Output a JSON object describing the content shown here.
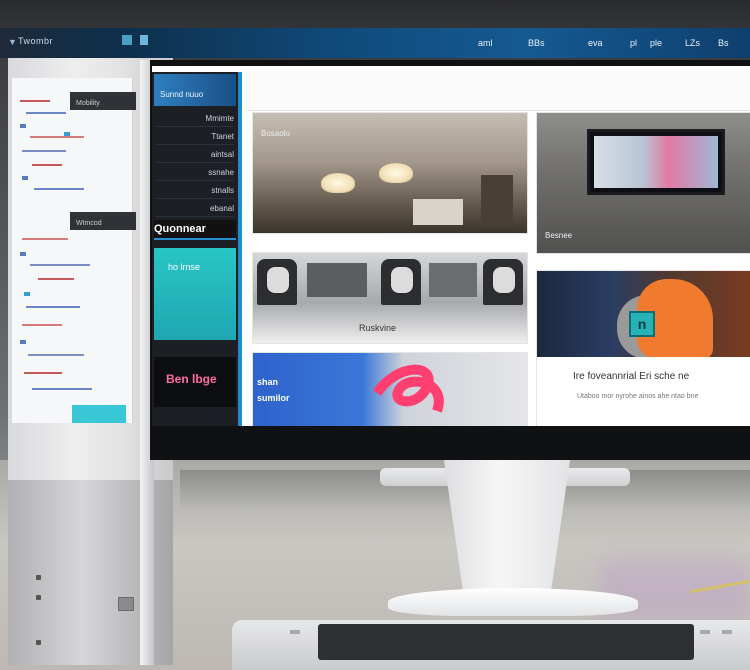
{
  "topbar": {
    "title": "Twombr",
    "items": [
      "aml",
      "BBs",
      "eva",
      "pl",
      "ple",
      "LZs",
      "Bs"
    ]
  },
  "doc_panel": {
    "headers": [
      "Mobility",
      "Wtmcod"
    ]
  },
  "sidebar": {
    "top_label": "Sunnd nuuo",
    "items": [
      "Mmimte",
      "Ttanet",
      "aintsal",
      "ssnahe",
      "stnalls",
      "ebanal"
    ],
    "bold_label": "Quonnear",
    "teal_label": "ho lrnse",
    "pink_label": "Ben lbge"
  },
  "cards": {
    "lobby_tag": "Bosaolo",
    "tv_tag": "Besnee",
    "printers_caption": "Ruskvine",
    "abstract_overlay": [
      "shan",
      "sumilor"
    ],
    "featured_caption": "Ire foveannrial Eri sche ne",
    "featured_sub": "Utaboo mor nyrohe ainos ahe ntao bne"
  }
}
